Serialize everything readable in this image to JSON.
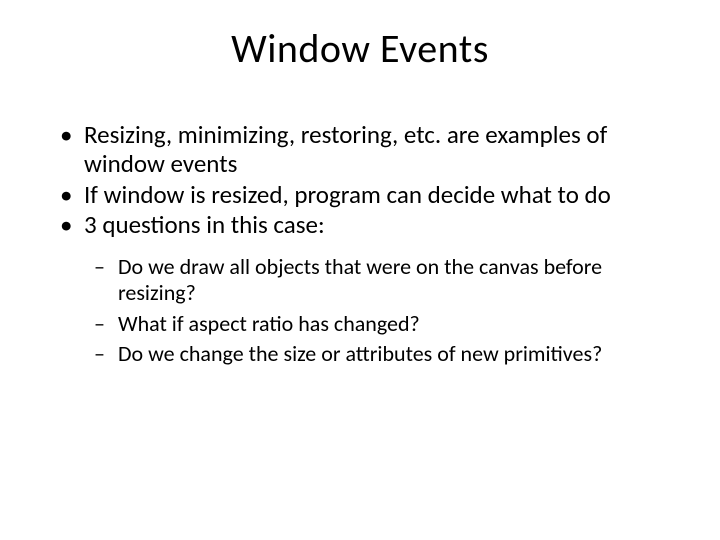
{
  "slide": {
    "title": "Window Events",
    "bullets": [
      "Resizing, minimizing, restoring, etc. are examples of window events",
      "If window is resized, program can decide what to do",
      "3 questions in this case:"
    ],
    "sub_bullets": [
      "Do we draw all objects that were on the canvas before resizing?",
      "What if aspect ratio has changed?",
      "Do we change the size or attributes of new primitives?"
    ]
  }
}
